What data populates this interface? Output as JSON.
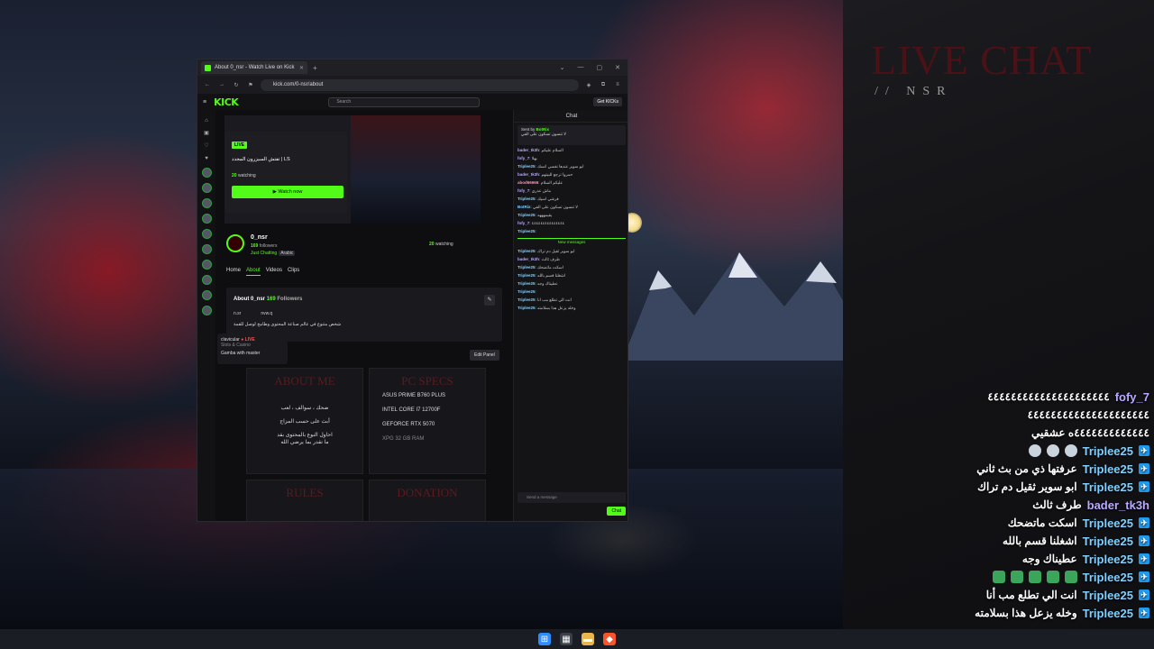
{
  "overlay": {
    "title": "LIVE CHAT",
    "subtitle": "// NSR",
    "messages": [
      {
        "user": "fofy_7",
        "text": "٤٤٤٤٤٤٤٤٤٤٤٤٤٤٤٤٤٤٤٤٤"
      },
      {
        "user": "",
        "text": "٤٤٤٤٤٤٤٤٤٤٤٤٤٤٤٤٤٤٤٤٤"
      },
      {
        "user": "",
        "text": "٤٤٤٤٤٤٤٤٤٤٤٤٤ه عشقيي"
      },
      {
        "user": "Triplee25",
        "text": ""
      },
      {
        "user": "Triplee25",
        "text": "عرفتها ذي من بث ثاني"
      },
      {
        "user": "Triplee25",
        "text": "ابو سوير ثقيل دم تراك"
      },
      {
        "user": "bader_tk3h",
        "text": "طرف ثالث"
      },
      {
        "user": "Triplee25",
        "text": "اسكت ماتضحك"
      },
      {
        "user": "Triplee25",
        "text": "اشغلنا قسم بالله"
      },
      {
        "user": "Triplee25",
        "text": "عطيناك وجه"
      },
      {
        "user": "Triplee25",
        "text": ""
      },
      {
        "user": "Triplee25",
        "text": "انت الي تطلع مب أنا"
      },
      {
        "user": "Triplee25",
        "text": "وخله يزعل هذا بسلامته"
      }
    ]
  },
  "browser": {
    "tab_title": "About 0_nsr - Watch Live on Kick",
    "url": "kick.com/0-nsr/about",
    "logo": "KICK",
    "search_placeholder": "Search",
    "get_kicks": "Get KICKs",
    "player": {
      "live": "LIVE",
      "title": "تفتش السيزرون المجدد | LS",
      "watching_count": "20",
      "watching_label": "watching",
      "watch_now": "Watch now"
    },
    "channel": {
      "name": "0_nsr",
      "followers_count": "169",
      "followers_label": "followers",
      "category": "Just Chatting",
      "tag": "Arabic",
      "watching_count": "20",
      "watching_label": "watching",
      "tabs": [
        "Home",
        "About",
        "Videos",
        "Clips"
      ]
    },
    "about": {
      "title": "About 0_nsr",
      "followers_count": "169",
      "followers_label": "Followers",
      "socials": [
        "n.sr",
        "nvw.q"
      ],
      "description": "شخص متنوع في عالم صناعة المحتوى وطامح لوصل للقمة",
      "edit_panel": "Edit Panel"
    },
    "tooltip": {
      "user": "clavicular",
      "live": "● LIVE",
      "category": "Slots & Casino",
      "title": "Gamba with master"
    },
    "panels": {
      "about_me": {
        "heading": "ABOUT ME",
        "lines": [
          "ضحك ، سوالف ، لعب",
          "أبث على حسب المزاج",
          "احاول النوع بالمحتوى بقد",
          "ما تقدر بما يرضي الله"
        ]
      },
      "pc_specs": {
        "heading": "PC SPECS",
        "lines": [
          "ASUS PRIME B760 PLUS",
          "INTEL CORE I7 12700F",
          "GEFORCE RTX 5070",
          "XPG 32 GB RAM"
        ]
      },
      "rules": "RULES",
      "donation": "DONATION"
    },
    "chat": {
      "header": "Chat",
      "pinned_by": "Sent by",
      "pinned_user": "BotRix",
      "pinned_text": "لا تنسون تسكون على الفي",
      "new_messages": "New messages",
      "input_placeholder": "Send a message",
      "send": "Chat",
      "messages": [
        {
          "user": "bader_tk3h",
          "text": "السلام عليكم",
          "cls": "u-purple"
        },
        {
          "user": "fofy_7",
          "text": "يهلا",
          "cls": "u-purple"
        },
        {
          "user": "Triplee25",
          "text": "ابو سوير عندها نفسي انسك",
          "cls": "u-blue"
        },
        {
          "user": "bader_tk3h",
          "text": "حمروا ترجع للبيتهم",
          "cls": "u-purple"
        },
        {
          "user": "abod66666",
          "text": "عليكم السلام",
          "cls": "u-pink"
        },
        {
          "user": "fofy_7",
          "text": "ماش عذري",
          "cls": "u-purple"
        },
        {
          "user": "Triplee25",
          "text": "فرشي اسيك",
          "cls": "u-blue"
        },
        {
          "user": "BotRix",
          "text": "لا تنسون تسكون على الفي",
          "cls": "u-blue"
        },
        {
          "user": "Triplee25",
          "text": "يقيمهههه",
          "cls": "u-blue"
        },
        {
          "user": "fofy_7",
          "text": "٤٤٤٤٤٤٤٤٤٤٤٤٤٤٤",
          "cls": "u-purple"
        },
        {
          "user": "Triplee25",
          "text": "",
          "cls": "u-blue"
        },
        {
          "user": "Triplee25",
          "text": "ابو سوير ثقيل دم تراك",
          "cls": "u-blue"
        },
        {
          "user": "bader_tk3h",
          "text": "طرف ثالث",
          "cls": "u-purple"
        },
        {
          "user": "Triplee25",
          "text": "اسكت ماتضحك",
          "cls": "u-blue"
        },
        {
          "user": "Triplee25",
          "text": "اشغلنا قسم بالله",
          "cls": "u-blue"
        },
        {
          "user": "Triplee25",
          "text": "عطيناك وجه",
          "cls": "u-blue"
        },
        {
          "user": "Triplee25",
          "text": "",
          "cls": "u-blue"
        },
        {
          "user": "Triplee25",
          "text": "انت الي تطلع مب أنا",
          "cls": "u-blue"
        },
        {
          "user": "Triplee25",
          "text": "وخله يزعل هذا بسلامته",
          "cls": "u-blue"
        }
      ]
    }
  },
  "taskbar": [
    "windows-icon",
    "store-icon",
    "folder-icon",
    "brave-icon"
  ],
  "colors": {
    "kick_green": "#53fc18",
    "overlay_blue": "#7fd0ff",
    "overlay_purple": "#b9a9ff",
    "title_red": "#4a1216"
  }
}
